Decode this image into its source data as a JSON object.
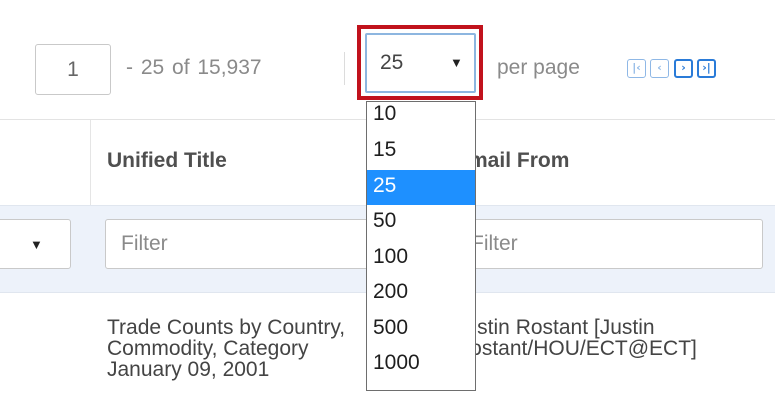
{
  "pagination": {
    "current_page": "1",
    "range_text": "- 25  of  15,937",
    "per_page_value": "25",
    "per_page_label": "per page",
    "per_page_options": [
      "10",
      "15",
      "25",
      "50",
      "100",
      "200",
      "500",
      "1000"
    ],
    "buttons": {
      "first": "|‹",
      "prev": "‹",
      "next": "›",
      "last": "›|"
    }
  },
  "table": {
    "columns": {
      "title": "Unified Title",
      "from": "Email From"
    },
    "filter_placeholder": "Filter",
    "rows": [
      {
        "title_lines": [
          "Trade Counts by Country,",
          "Commodity, Category",
          "January 09, 2001"
        ],
        "from_lines": [
          "Justin Rostant [Justin",
          "Rostant/HOU/ECT@ECT]"
        ]
      }
    ]
  },
  "colors": {
    "highlight": "#c1121c",
    "selected_option": "#1e90ff",
    "pager_accent": "#2a7bd8",
    "filter_row_bg": "#edf2fa"
  }
}
